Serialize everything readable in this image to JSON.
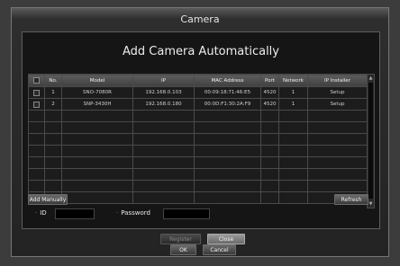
{
  "window": {
    "title": "Camera"
  },
  "dialog": {
    "title": "Add Camera Automatically"
  },
  "table": {
    "headers": [
      "",
      "No.",
      "Model",
      "IP",
      "MAC Address",
      "Port",
      "Network",
      "IP Installer"
    ],
    "rows": [
      {
        "no": "1",
        "model": "SNO-7080R",
        "ip": "192.168.0.103",
        "mac": "00:09:18:71:46:E5",
        "port": "4520",
        "network": "1",
        "installer": "Setup"
      },
      {
        "no": "2",
        "model": "SNP-3430H",
        "ip": "192.168.0.180",
        "mac": "00:0D:F1:30:2A:F9",
        "port": "4520",
        "network": "1",
        "installer": "Setup"
      }
    ]
  },
  "buttons": {
    "add_manually": "Add Manually",
    "refresh": "Refresh",
    "register": "Register",
    "close": "Close",
    "ok": "OK",
    "cancel": "Cancel"
  },
  "fields": {
    "id_label": "ID",
    "password_label": "Password"
  }
}
